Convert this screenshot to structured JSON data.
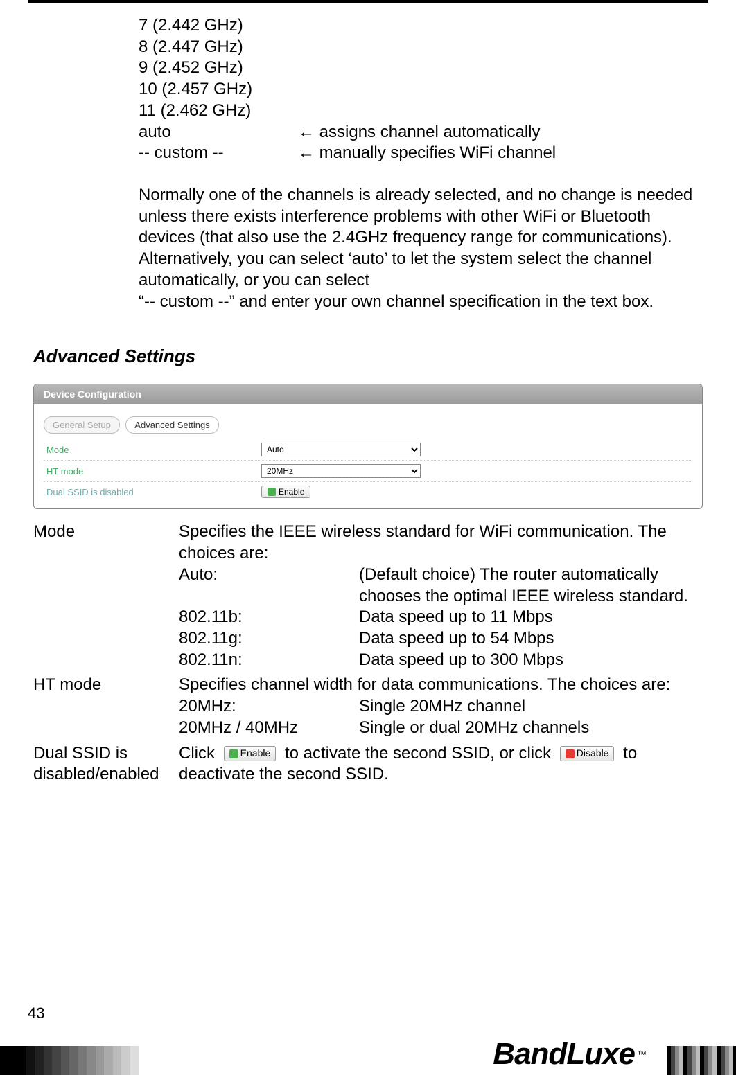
{
  "channels": {
    "c7": "7 (2.442 GHz)",
    "c8": "8 (2.447 GHz)",
    "c9": "9 (2.452 GHz)",
    "c10": "10 (2.457 GHz)",
    "c11": "11 (2.462 GHz)",
    "auto_label": "auto",
    "auto_arrow": "← assigns channel automatically",
    "custom_label": "-- custom --",
    "custom_arrow": "← manually specifies WiFi channel"
  },
  "paragraph": {
    "line1": "Normally one of the channels is already selected, and no change is needed unless there exists interference problems with other WiFi or Bluetooth devices (that also use the 2.4GHz frequency range for communications).",
    "line2": "Alternatively, you can select ‘auto’ to let the system select the channel automatically, or you can select",
    "line3": "“-- custom --” and enter your own channel specification in the text box."
  },
  "section_heading": "Advanced Settings",
  "screenshot": {
    "panel_title": "Device Configuration",
    "tab_inactive": "General Setup",
    "tab_active": "Advanced Settings",
    "row_mode_label": "Mode",
    "row_mode_value": "Auto",
    "row_ht_label": "HT mode",
    "row_ht_value": "20MHz",
    "row_ssid_label": "Dual SSID is disabled",
    "enable_btn": "Enable"
  },
  "defs": {
    "mode": {
      "term": "Mode",
      "intro": "Specifies the IEEE wireless standard for WiFi communication. The choices are:",
      "auto_k": "Auto:",
      "auto_v": "(Default choice) The router automatically chooses the optimal IEEE wireless standard.",
      "b_k": "802.11b:",
      "b_v": "Data speed up to 11 Mbps",
      "g_k": "802.11g:",
      "g_v": "Data speed up to 54 Mbps",
      "n_k": "802.11n:",
      "n_v": "Data speed up to 300 Mbps"
    },
    "ht": {
      "term": "HT mode",
      "intro": "Specifies channel width for data communications. The choices are:",
      "a_k": "20MHz:",
      "a_v": "Single 20MHz channel",
      "b_k": "20MHz / 40MHz",
      "b_v": "Single or dual 20MHz channels"
    },
    "ssid": {
      "term": "Dual SSID is disabled/enabled",
      "pre": "Click ",
      "enable_btn": "Enable",
      "mid": " to activate the second SSID, or click ",
      "disable_btn": "Disable",
      "post": " to deactivate the second SSID."
    }
  },
  "page_number": "43",
  "brand": "BandLuxe",
  "tm": "™"
}
